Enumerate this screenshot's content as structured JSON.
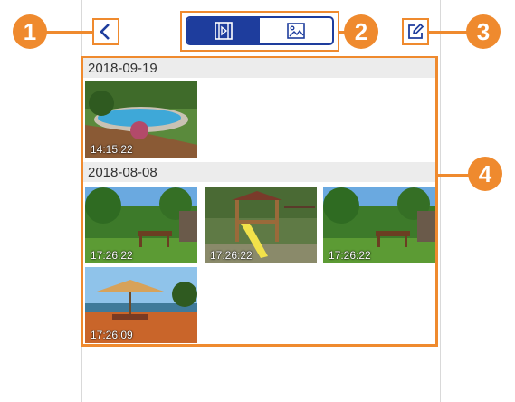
{
  "header": {
    "back_icon": "chevron-left-icon",
    "tabs": [
      {
        "name": "video",
        "icon": "video-icon",
        "active": true
      },
      {
        "name": "image",
        "icon": "image-icon",
        "active": false
      }
    ],
    "edit_icon": "edit-icon"
  },
  "callouts": [
    "1",
    "2",
    "3",
    "4"
  ],
  "groups": [
    {
      "date": "2018-09-19",
      "items": [
        {
          "time": "14:15:22",
          "scene": "pool"
        }
      ]
    },
    {
      "date": "2018-08-08",
      "items": [
        {
          "time": "17:26:22",
          "scene": "garden"
        },
        {
          "time": "17:26:22",
          "scene": "playset"
        },
        {
          "time": "17:26:22",
          "scene": "garden"
        },
        {
          "time": "17:26:09",
          "scene": "patio"
        }
      ]
    }
  ],
  "colors": {
    "accent": "#ef8a2e",
    "brand": "#1e3d9d"
  }
}
